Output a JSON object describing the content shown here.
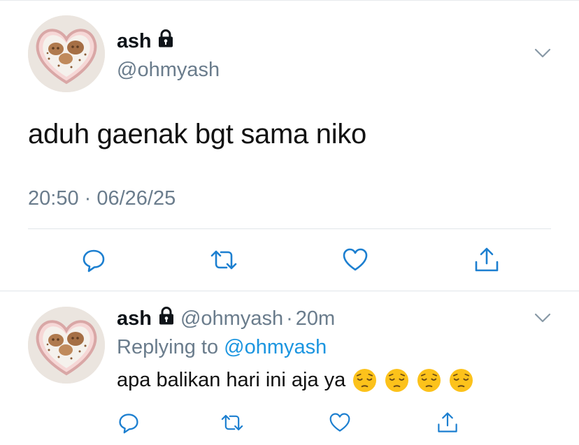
{
  "main_tweet": {
    "author_name": "ash",
    "author_handle": "@ohmyash",
    "text": "aduh gaenak bgt sama niko",
    "timestamp": "20:50 · 06/26/25",
    "icons": {
      "lock": "lock-icon",
      "menu": "chevron-down-icon",
      "reply": "reply-icon",
      "retweet": "retweet-icon",
      "like": "like-icon",
      "share": "share-icon"
    }
  },
  "reply_tweet": {
    "author_name": "ash",
    "author_handle": "@ohmyash",
    "separator": "·",
    "age": "20m",
    "replying_prefix": "Replying to",
    "replying_handle": "@ohmyash",
    "text": "apa balikan hari ini aja ya",
    "emojis": [
      "pensive-face",
      "pensive-face",
      "pensive-face",
      "pensive-face"
    ]
  },
  "colors": {
    "text_primary": "#0f1419",
    "text_secondary": "#6a7c8c",
    "link": "#1b95e0",
    "icon": "#1c7fd0",
    "divider": "#e1e6ea"
  }
}
